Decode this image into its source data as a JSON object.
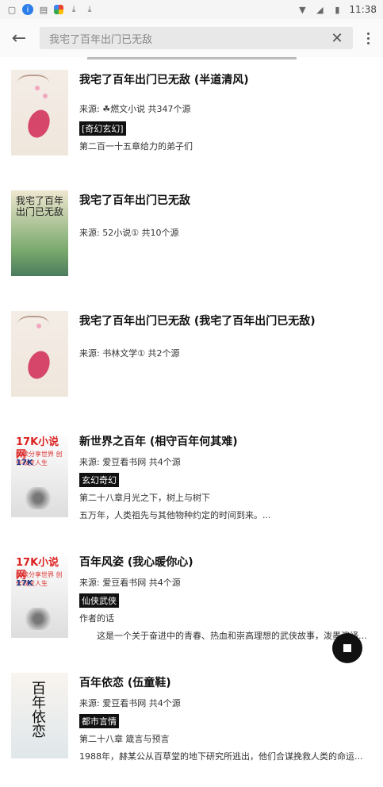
{
  "status_bar": {
    "time": "11:38"
  },
  "search": {
    "query": "我宅了百年出门已无敌"
  },
  "books": [
    {
      "title": "我宅了百年出门已无敌 (半道清风)",
      "source": "来源: ☘燃文小说 共347个源",
      "tag": "[奇幻玄幻]",
      "chapter": "第二百一十五章给力的弟子们",
      "intro": ""
    },
    {
      "title": "我宅了百年出门已无敌",
      "source": "来源: 52小说① 共10个源",
      "tag": "",
      "chapter": "",
      "intro": ""
    },
    {
      "title": "我宅了百年出门已无敌 (我宅了百年出门已无敌)",
      "source": "来源: 书林文学① 共2个源",
      "tag": "",
      "chapter": "",
      "intro": ""
    },
    {
      "title": "新世界之百年 (相守百年何其难)",
      "source": "来源: 爱豆看书网 共4个源",
      "tag": "玄幻奇幻",
      "chapter": "第二十八章月光之下，树上与树下",
      "intro": "五万年，人类祖先与其他物种约定的时间到来。..."
    },
    {
      "title": "百年风姿 (我心暖你心)",
      "source": "来源: 爱豆看书网 共4个源",
      "tag": "仙侠武侠",
      "chapter": "作者的话",
      "intro": "　　这是一个关于奋进中的青春、热血和崇高理想的武侠故事，泼墨演绎中..."
    },
    {
      "title": "百年依恋 (伍童鞋)",
      "source": "来源: 爱豆看书网 共4个源",
      "tag": "都市言情",
      "chapter": "第二十八章 箴言与预言",
      "intro": "1988年，赫某公从百草堂的地下研究所逃出，他们合谋挽救人类的命运..."
    }
  ],
  "covers": {
    "cover2": {
      "title": "我宅了百年出门已无敌"
    },
    "cover4": {
      "title": "17K小说网",
      "sub": "阅读分享世界 创作改变人生",
      "logo": "17K"
    },
    "cover5": {
      "title": "17K小说网",
      "sub": "阅读分享世界 创作改变人生",
      "logo": "17K"
    },
    "cover6": {
      "title": "百年依恋"
    }
  }
}
